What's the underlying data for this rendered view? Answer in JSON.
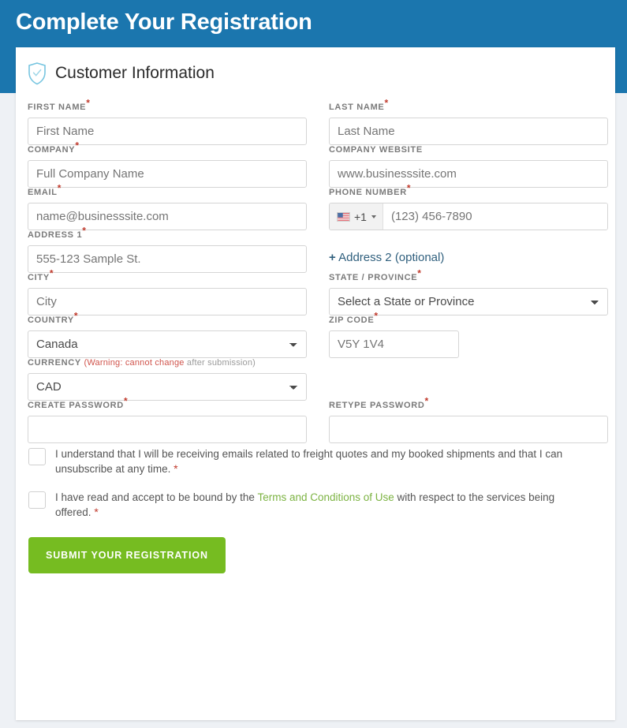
{
  "header": {
    "title": "Complete Your Registration",
    "background_color": "#1b76ae"
  },
  "card": {
    "section_icon": "shield-check-icon",
    "section_title": "Customer Information"
  },
  "form": {
    "first_name": {
      "label": "FIRST NAME",
      "required": "*",
      "placeholder": "First Name",
      "value": ""
    },
    "last_name": {
      "label": "LAST NAME",
      "required": "*",
      "placeholder": "Last Name",
      "value": ""
    },
    "company": {
      "label": "COMPANY",
      "required": "*",
      "placeholder": "Full Company Name",
      "value": ""
    },
    "company_website": {
      "label": "COMPANY WEBSITE",
      "required": "",
      "placeholder": "www.businesssite.com",
      "value": ""
    },
    "email": {
      "label": "EMAIL",
      "required": "*",
      "placeholder": "name@businesssite.com",
      "value": ""
    },
    "phone": {
      "label": "PHONE NUMBER",
      "required": "*",
      "country_flag": "us-flag-icon",
      "dial_code": "+1",
      "placeholder": "(123) 456-7890",
      "value": ""
    },
    "address1": {
      "label": "ADDRESS 1",
      "required": "*",
      "placeholder": "555-123 Sample St.",
      "value": ""
    },
    "address2_link": {
      "plus": "+",
      "label": "Address 2 (optional)"
    },
    "city": {
      "label": "CITY",
      "required": "*",
      "placeholder": "City",
      "value": ""
    },
    "state_province": {
      "label": "STATE / PROVINCE",
      "required": "*",
      "selected": "Select a State or Province",
      "options": [
        "Select a State or Province"
      ]
    },
    "country": {
      "label": "COUNTRY",
      "required": "*",
      "selected": "Canada",
      "options": [
        "Canada"
      ]
    },
    "zip_code": {
      "label": "ZIP CODE",
      "required": "*",
      "placeholder": "V5Y 1V4",
      "value": ""
    },
    "currency": {
      "label": "CURRENCY",
      "warning_red": "(Warning: cannot change",
      "warning_gray": " after submission)",
      "selected": "CAD",
      "options": [
        "CAD"
      ]
    },
    "create_password": {
      "label": "CREATE PASSWORD",
      "required": "*",
      "placeholder": "",
      "value": ""
    },
    "retype_password": {
      "label": "RETYPE PASSWORD",
      "required": "*",
      "placeholder": "",
      "value": ""
    }
  },
  "consents": {
    "emails": {
      "text": "I understand that I will be receiving emails related to freight quotes and my booked shipments and that I can unsubscribe at any time.",
      "required": "*",
      "checked": false
    },
    "terms": {
      "text_before": "I have read and accept to be bound by the ",
      "link_text": "Terms and Conditions of Use",
      "text_after": " with respect to the services being offered.",
      "required": "*",
      "checked": false
    }
  },
  "submit": {
    "label": "Submit Your Registration",
    "color": "#76bc21"
  }
}
